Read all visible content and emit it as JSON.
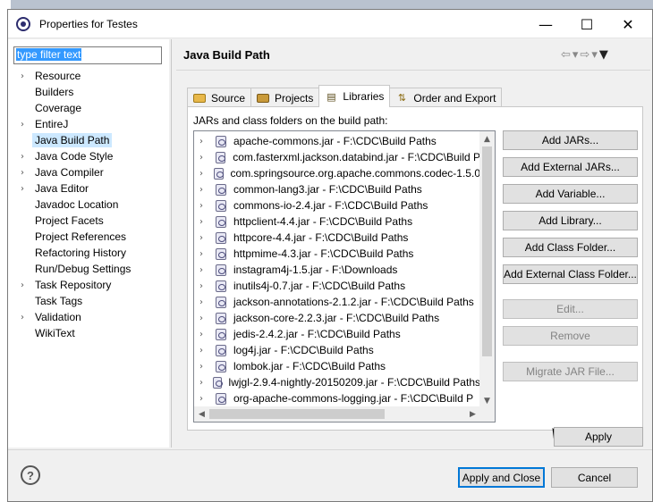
{
  "window": {
    "title": "Properties for Testes",
    "minimize_glyph": "—",
    "maximize_glyph": "☐",
    "close_glyph": "✕"
  },
  "sidebar": {
    "filter_text": "type filter text",
    "items": [
      {
        "label": "Resource",
        "expandable": true
      },
      {
        "label": "Builders",
        "expandable": false
      },
      {
        "label": "Coverage",
        "expandable": false
      },
      {
        "label": "EntireJ",
        "expandable": true
      },
      {
        "label": "Java Build Path",
        "expandable": false,
        "selected": true
      },
      {
        "label": "Java Code Style",
        "expandable": true
      },
      {
        "label": "Java Compiler",
        "expandable": true
      },
      {
        "label": "Java Editor",
        "expandable": true
      },
      {
        "label": "Javadoc Location",
        "expandable": false
      },
      {
        "label": "Project Facets",
        "expandable": false
      },
      {
        "label": "Project References",
        "expandable": false
      },
      {
        "label": "Refactoring History",
        "expandable": false
      },
      {
        "label": "Run/Debug Settings",
        "expandable": false
      },
      {
        "label": "Task Repository",
        "expandable": true
      },
      {
        "label": "Task Tags",
        "expandable": false
      },
      {
        "label": "Validation",
        "expandable": true
      },
      {
        "label": "WikiText",
        "expandable": false
      }
    ]
  },
  "main": {
    "title": "Java Build Path",
    "tabs": [
      {
        "label": "Source",
        "active": false
      },
      {
        "label": "Projects",
        "active": false
      },
      {
        "label": "Libraries",
        "active": true
      },
      {
        "label": "Order and Export",
        "active": false
      }
    ],
    "jars_label": "JARs and class folders on the build path:",
    "jars": [
      "apache-commons.jar - F:\\CDC\\Build Paths",
      "com.fasterxml.jackson.databind.jar - F:\\CDC\\Build P",
      "com.springsource.org.apache.commons.codec-1.5.0",
      "common-lang3.jar - F:\\CDC\\Build Paths",
      "commons-io-2.4.jar - F:\\CDC\\Build Paths",
      "httpclient-4.4.jar - F:\\CDC\\Build Paths",
      "httpcore-4.4.jar - F:\\CDC\\Build Paths",
      "httpmime-4.3.jar - F:\\CDC\\Build Paths",
      "instagram4j-1.5.jar - F:\\Downloads",
      "inutils4j-0.7.jar - F:\\CDC\\Build Paths",
      "jackson-annotations-2.1.2.jar - F:\\CDC\\Build Paths",
      "jackson-core-2.2.3.jar - F:\\CDC\\Build Paths",
      "jedis-2.4.2.jar - F:\\CDC\\Build Paths",
      "log4j.jar - F:\\CDC\\Build Paths",
      "lombok.jar - F:\\CDC\\Build Paths",
      "lwjgl-2.9.4-nightly-20150209.jar - F:\\CDC\\Build Paths",
      "org-apache-commons-logging.jar - F:\\CDC\\Build P"
    ],
    "buttons": [
      {
        "label": "Add JARs...",
        "enabled": true
      },
      {
        "label": "Add External JARs...",
        "enabled": true
      },
      {
        "label": "Add Variable...",
        "enabled": true
      },
      {
        "label": "Add Library...",
        "enabled": true
      },
      {
        "label": "Add Class Folder...",
        "enabled": true
      },
      {
        "label": "Add External Class Folder...",
        "enabled": true
      },
      {
        "label": "Edit...",
        "enabled": false
      },
      {
        "label": "Remove",
        "enabled": false
      },
      {
        "label": "Migrate JAR File...",
        "enabled": false
      }
    ],
    "apply_label": "Apply"
  },
  "footer": {
    "help_glyph": "?",
    "apply_close_label": "Apply and Close",
    "cancel_label": "Cancel"
  }
}
